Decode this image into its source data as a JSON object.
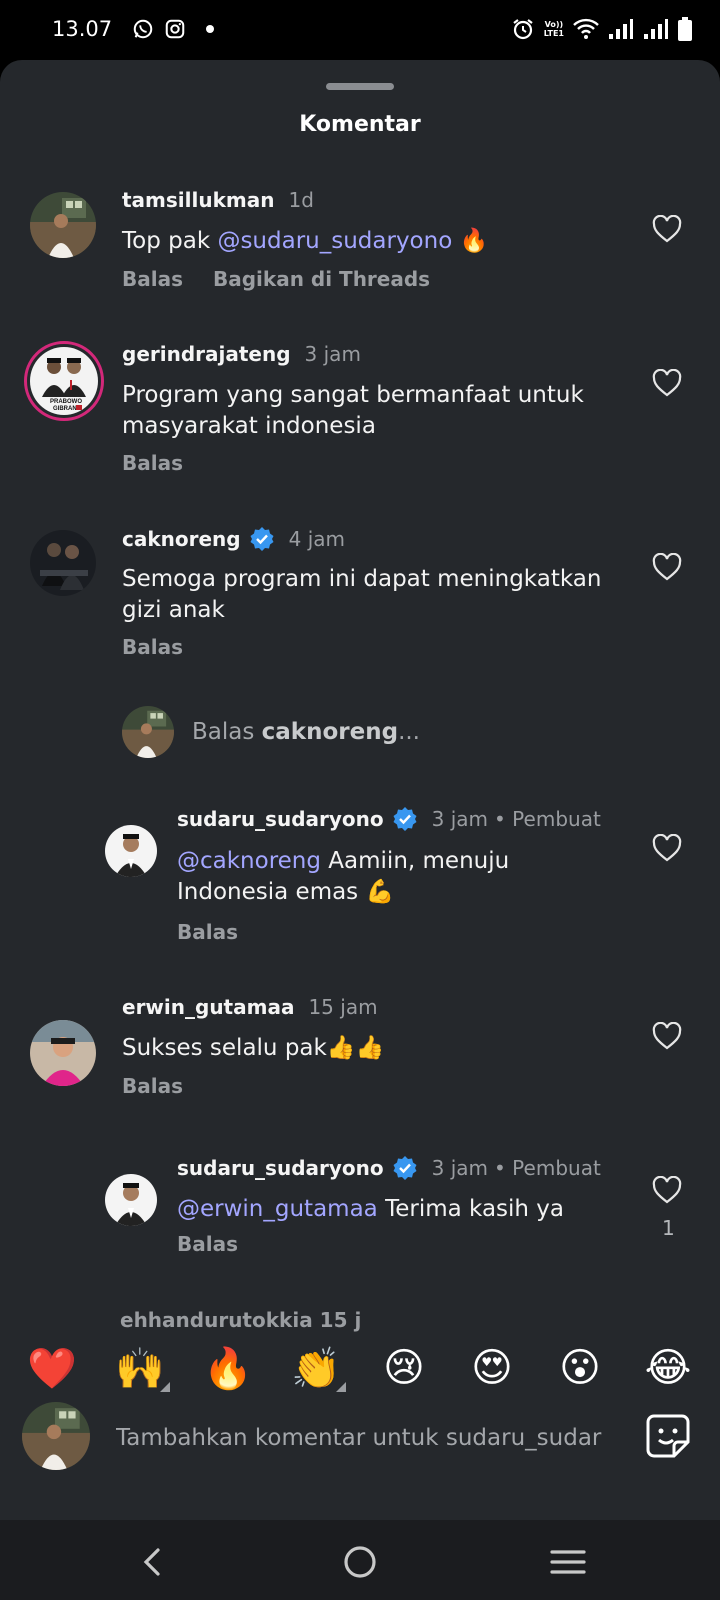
{
  "status_bar": {
    "time": "13.07",
    "lte_top": "Vo))",
    "lte_bottom": "LTE1"
  },
  "sheet": {
    "title": "Komentar"
  },
  "comments": [
    {
      "username": "tamsillukman",
      "time": "1d",
      "text_pre": "Top pak ",
      "mention": "@sudaru_sudaryono",
      "text_post": " 🔥",
      "actions": [
        "Balas",
        "Bagikan di Threads"
      ]
    },
    {
      "username": "gerindrajateng",
      "time": "3 jam",
      "text": "Program yang sangat bermanfaat untuk masyarakat indonesia",
      "actions": [
        "Balas"
      ],
      "avatar_caption_1": "PRABOWO",
      "avatar_caption_2": "GIBRAN"
    },
    {
      "username": "caknoreng",
      "verified": true,
      "time": "4 jam",
      "text": "Semoga program ini dapat meningkatkan gizi anak",
      "actions": [
        "Balas"
      ]
    },
    {
      "username": "sudaru_sudaryono",
      "verified": true,
      "time": "3 jam",
      "creator_label": "• Pembuat",
      "mention": "@caknoreng",
      "text_post": " Aamiin, menuju Indonesia emas 💪",
      "actions": [
        "Balas"
      ]
    },
    {
      "username": "erwin_gutamaa",
      "time": "15 jam",
      "text": "Sukses selalu pak👍👍",
      "actions": [
        "Balas"
      ]
    },
    {
      "username": "sudaru_sudaryono",
      "verified": true,
      "time": "3 jam",
      "creator_label": "• Pembuat",
      "mention": "@erwin_gutamaa",
      "text_post": " Terima  kasih ya",
      "actions": [
        "Balas"
      ],
      "likes": "1"
    }
  ],
  "reply_prompt": {
    "prefix": "Balas ",
    "username": "caknoreng",
    "suffix": "..."
  },
  "peek_row": {
    "text": "ehhandurutokkia  15 j"
  },
  "emoji_bar": [
    "❤️",
    "🙌",
    "🔥",
    "👏",
    "😢",
    "😍",
    "😮",
    "😂"
  ],
  "composer": {
    "placeholder": "Tambahkan komentar untuk sudaru_sudar"
  },
  "colors": {
    "sheet_bg": "#25282c",
    "mention": "#a3a6ff",
    "verified": "#3897f0"
  }
}
